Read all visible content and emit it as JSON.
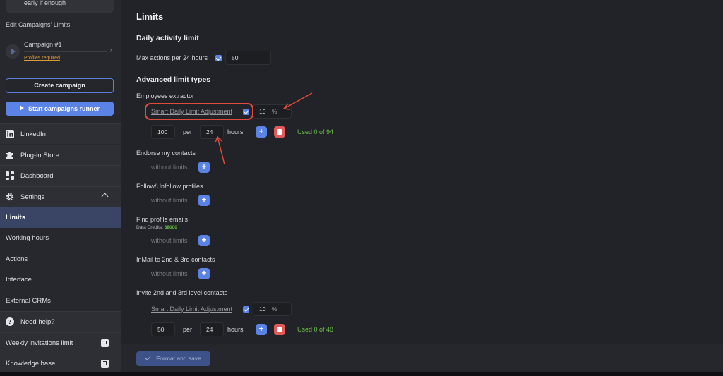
{
  "sidebar": {
    "prev_item_text": "early if enough",
    "edit_link": "Edit Campaigns' Limits",
    "campaign": {
      "name": "Campaign #1",
      "status": "Profiles required"
    },
    "create_button": "Create campaign",
    "runner_button": "Start campaigns runner",
    "nav": {
      "linkedin": "LinkedIn",
      "plugin_store": "Plug-in Store",
      "dashboard": "Dashboard",
      "settings": "Settings",
      "limits": "Limits",
      "working_hours": "Working hours",
      "actions": "Actions",
      "interface": "Interface",
      "external_crms": "External CRMs",
      "need_help": "Need help?",
      "weekly_invitations": "Weekly invitations limit",
      "knowledge_base": "Knowledge base"
    }
  },
  "main": {
    "title": "Limits",
    "daily": {
      "heading": "Daily activity limit",
      "label": "Max actions per 24 hours",
      "value": "50"
    },
    "advanced_heading": "Advanced limit types",
    "employees": {
      "label": "Employees extractor",
      "sdl_label": "Smart Daily Limit Adjustment",
      "sdl_value": "10",
      "pct": "%",
      "amount": "100",
      "per": "per",
      "hours_value": "24",
      "hours": "hours",
      "used": "Used 0 of 94"
    },
    "endorse": {
      "label": "Endorse my contacts",
      "value": "without limits"
    },
    "follow": {
      "label": "Follow/Unfollow profiles",
      "value": "without limits"
    },
    "emails": {
      "label": "Find profile emails",
      "credits_label": "Data Credits:",
      "credits_value": "38000",
      "value": "without limits"
    },
    "inmail": {
      "label": "InMail to 2nd & 3rd contacts",
      "value": "without limits"
    },
    "invite": {
      "label": "Invite 2nd and 3rd level contacts",
      "sdl_label": "Smart Daily Limit Adjustment",
      "sdl_value": "10",
      "pct": "%",
      "amount": "50",
      "per": "per",
      "hours_value": "24",
      "hours": "hours",
      "used": "Used 0 of 48"
    },
    "save_button": "Format and save"
  },
  "colors": {
    "accent": "#5b83e6",
    "danger": "#e25a5a",
    "success": "#6cc04a",
    "annotation": "#e14a3c"
  }
}
